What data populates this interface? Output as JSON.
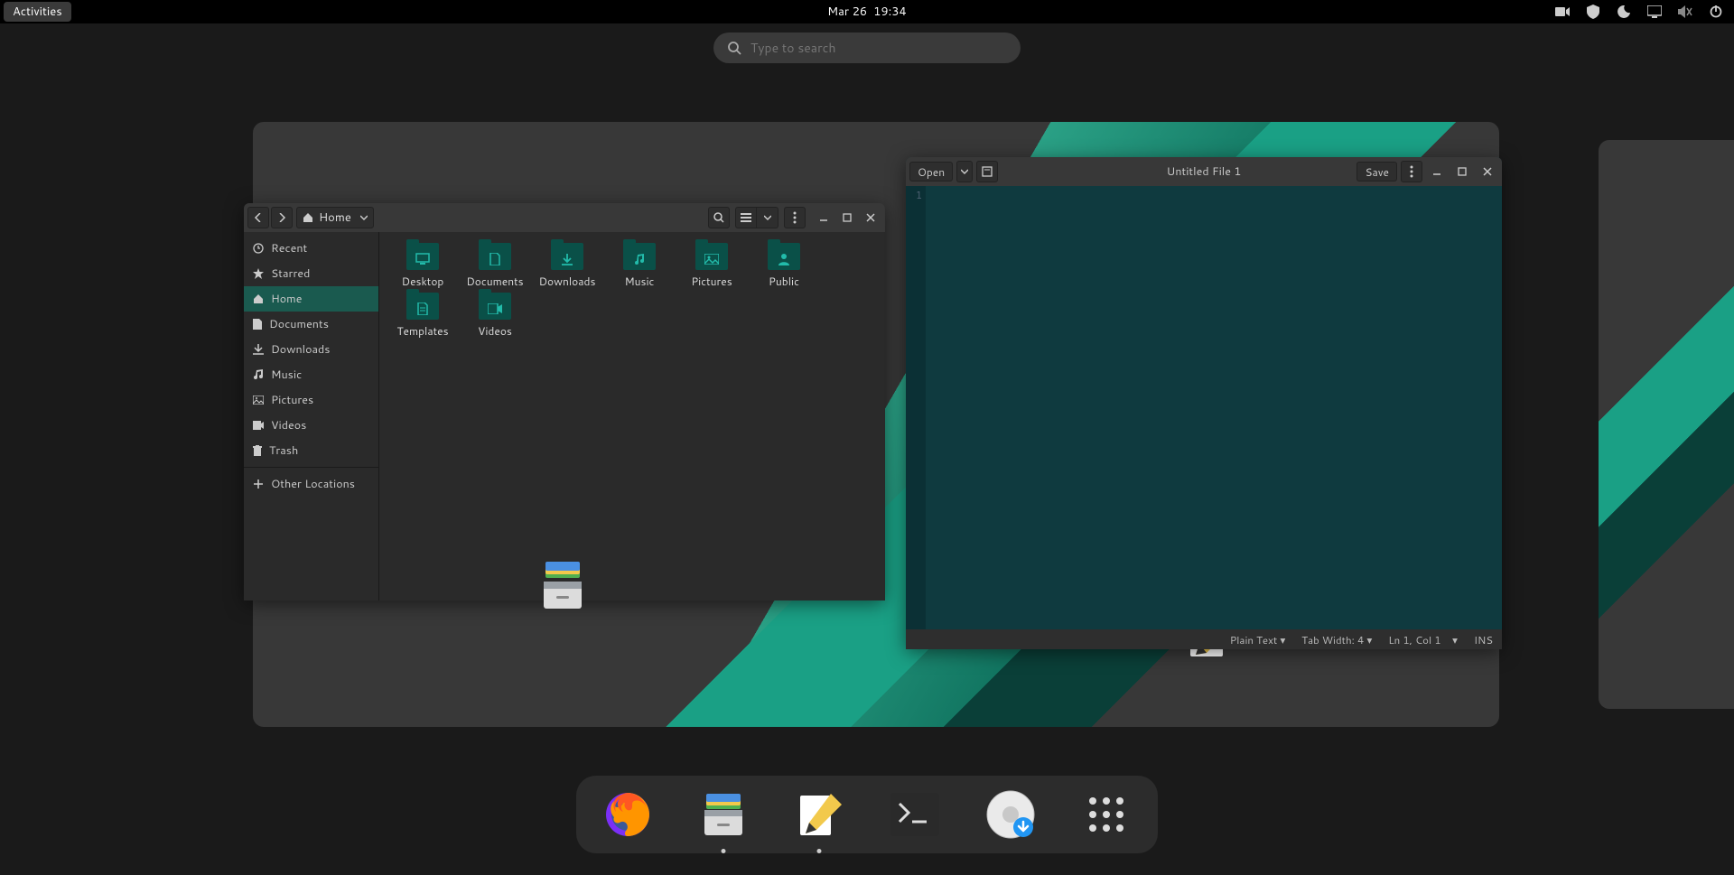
{
  "topbar": {
    "activities": "Activities",
    "date": "Mar 26",
    "time": "19:34"
  },
  "search": {
    "placeholder": "Type to search"
  },
  "files_window": {
    "breadcrumb": "Home",
    "sidebar": [
      {
        "icon": "clock",
        "label": "Recent"
      },
      {
        "icon": "star",
        "label": "Starred"
      },
      {
        "icon": "home",
        "label": "Home",
        "active": true
      },
      {
        "icon": "doc",
        "label": "Documents"
      },
      {
        "icon": "download",
        "label": "Downloads"
      },
      {
        "icon": "music",
        "label": "Music"
      },
      {
        "icon": "picture",
        "label": "Pictures"
      },
      {
        "icon": "video",
        "label": "Videos"
      },
      {
        "icon": "trash",
        "label": "Trash"
      }
    ],
    "other_locations": "Other Locations",
    "folders": [
      {
        "name": "Desktop",
        "badge": "monitor"
      },
      {
        "name": "Documents",
        "badge": "doc"
      },
      {
        "name": "Downloads",
        "badge": "download"
      },
      {
        "name": "Music",
        "badge": "music"
      },
      {
        "name": "Pictures",
        "badge": "picture"
      },
      {
        "name": "Public",
        "badge": "public"
      },
      {
        "name": "Templates",
        "badge": "template"
      },
      {
        "name": "Videos",
        "badge": "video"
      }
    ]
  },
  "editor_window": {
    "open_label": "Open",
    "save_label": "Save",
    "title": "Untitled File 1",
    "line_number": "1",
    "status": {
      "syntax": "Plain Text",
      "tab_width": "Tab Width: 4",
      "position": "Ln 1, Col 1",
      "mode": "INS"
    }
  },
  "dock": {
    "items": [
      {
        "name": "firefox",
        "running": false
      },
      {
        "name": "files",
        "running": true
      },
      {
        "name": "text-editor",
        "running": true
      },
      {
        "name": "terminal",
        "running": false
      },
      {
        "name": "software-updater",
        "running": false
      },
      {
        "name": "app-grid",
        "running": false
      }
    ]
  }
}
